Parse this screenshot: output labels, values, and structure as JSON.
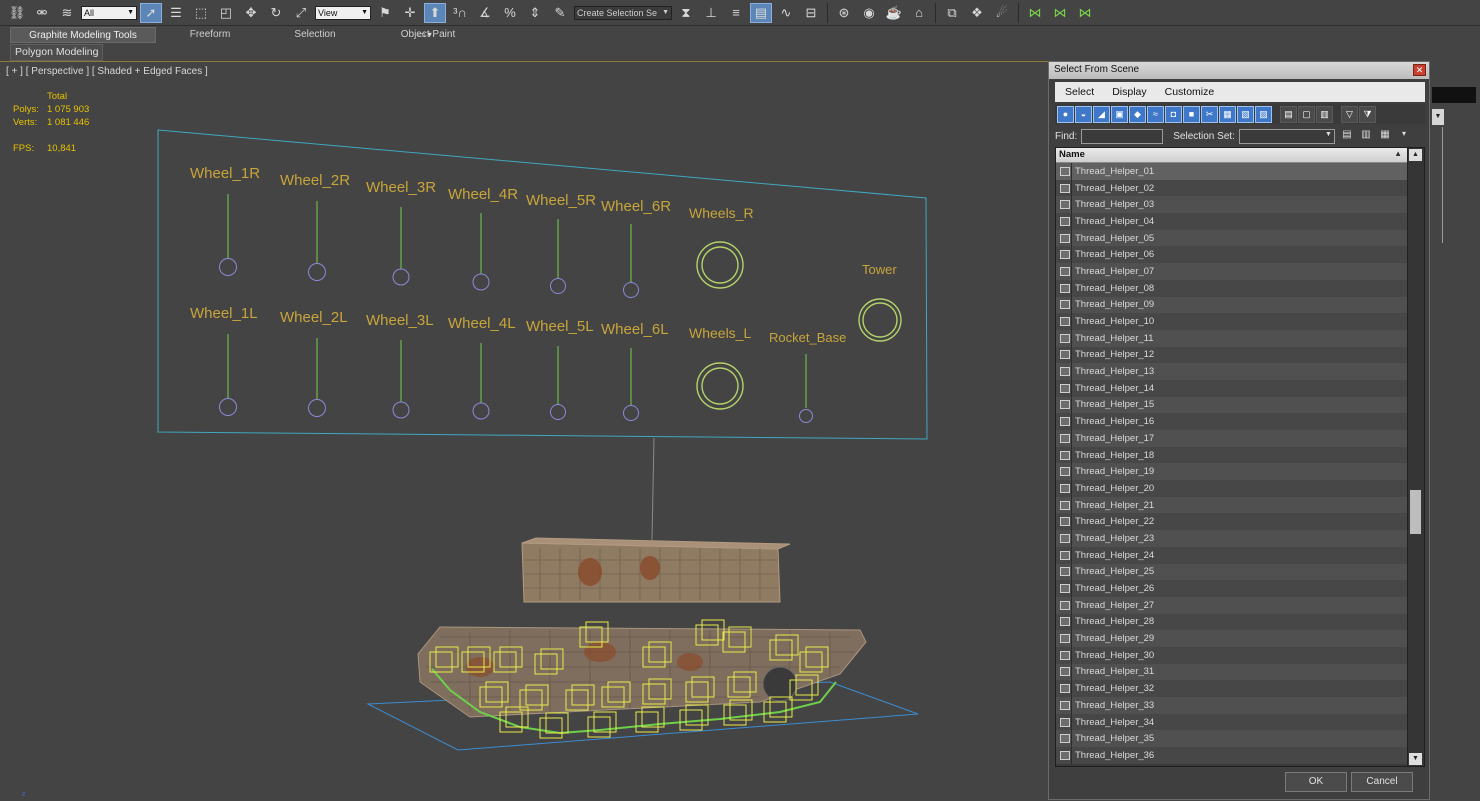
{
  "toolbar": {
    "selection_filter": "All",
    "reference_coord": "View",
    "named_selection_placeholder": "Create Selection Se",
    "icons": [
      "link-icon",
      "unlink-icon",
      "bind-spacewarp-icon",
      "select-object-icon",
      "select-by-name-icon",
      "rect-region-icon",
      "window-crossing-icon",
      "move-icon",
      "rotate-icon",
      "scale-icon",
      "pivot-icon",
      "manipulate-icon",
      "snap-3d-icon",
      "angle-snap-icon",
      "percent-snap-icon",
      "spinner-snap-icon",
      "edit-named-sets-icon",
      "mirror-icon",
      "align-icon",
      "layer-explorer-icon",
      "scene-explorer-icon",
      "curve-editor-icon",
      "schematic-view-icon",
      "material-editor-icon",
      "render-setup-icon",
      "rendered-frame-icon",
      "render-icon"
    ]
  },
  "ribbon": {
    "tabs": [
      "Graphite Modeling Tools",
      "Freeform",
      "Selection",
      "Object Paint"
    ],
    "panel_label": "Polygon Modeling"
  },
  "viewport": {
    "label": "[ + ] [ Perspective ] [ Shaded + Edged Faces ]",
    "stats": {
      "header": "Total",
      "polys_label": "Polys:",
      "polys_value": "1 075 903",
      "verts_label": "Verts:",
      "verts_value": "1 081 446",
      "fps_label": "FPS:",
      "fps_value": "10,841"
    },
    "controls_top": [
      "Wheel_1R",
      "Wheel_2R",
      "Wheel_3R",
      "Wheel_4R",
      "Wheel_5R",
      "Wheel_6R",
      "Wheels_R",
      "Tower"
    ],
    "controls_bottom": [
      "Wheel_1L",
      "Wheel_2L",
      "Wheel_3L",
      "Wheel_4L",
      "Wheel_5L",
      "Wheel_6L",
      "Wheels_L",
      "Rocket_Base"
    ],
    "axis_label": "z"
  },
  "dialog": {
    "title": "Select From Scene",
    "menus": [
      "Select",
      "Display",
      "Customize"
    ],
    "find_label": "Find:",
    "selection_set_label": "Selection Set:",
    "column_header": "Name",
    "items": [
      "Thread_Helper_01",
      "Thread_Helper_02",
      "Thread_Helper_03",
      "Thread_Helper_04",
      "Thread_Helper_05",
      "Thread_Helper_06",
      "Thread_Helper_07",
      "Thread_Helper_08",
      "Thread_Helper_09",
      "Thread_Helper_10",
      "Thread_Helper_11",
      "Thread_Helper_12",
      "Thread_Helper_13",
      "Thread_Helper_14",
      "Thread_Helper_15",
      "Thread_Helper_16",
      "Thread_Helper_17",
      "Thread_Helper_18",
      "Thread_Helper_19",
      "Thread_Helper_20",
      "Thread_Helper_21",
      "Thread_Helper_22",
      "Thread_Helper_23",
      "Thread_Helper_24",
      "Thread_Helper_25",
      "Thread_Helper_26",
      "Thread_Helper_27",
      "Thread_Helper_28",
      "Thread_Helper_29",
      "Thread_Helper_30",
      "Thread_Helper_31",
      "Thread_Helper_32",
      "Thread_Helper_33",
      "Thread_Helper_34",
      "Thread_Helper_35",
      "Thread_Helper_36"
    ],
    "ok_label": "OK",
    "cancel_label": "Cancel"
  },
  "colors": {
    "control_text": "#c8a53a",
    "stats_text": "#e6c200",
    "helper_green": "#7bd44a",
    "helper_yellow": "#e8ea4a",
    "panel_outline": "#3fa7c0",
    "accent_blue": "#5d86b8"
  }
}
